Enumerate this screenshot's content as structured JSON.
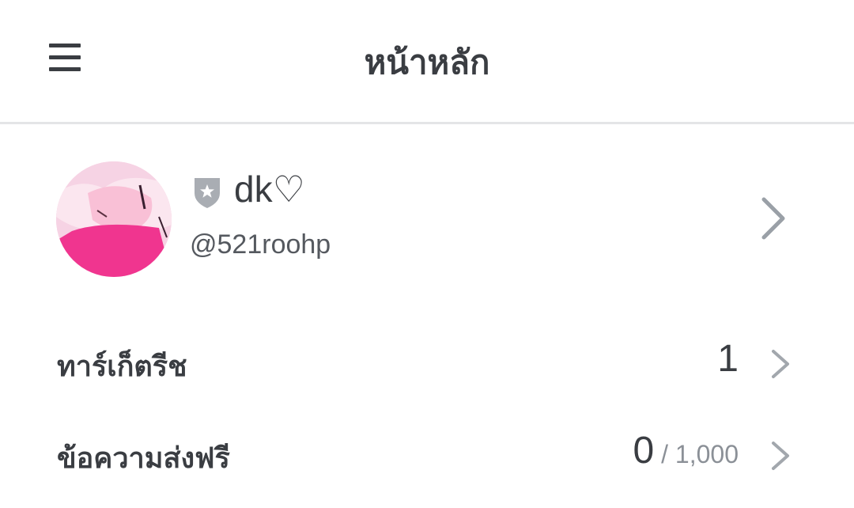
{
  "header": {
    "title": "หน้าหลัก",
    "menu_icon": "hamburger-menu-icon"
  },
  "profile": {
    "display_name": "dk♡",
    "handle": "@521roohp",
    "badge_icon": "shield-star-icon",
    "chevron_icon": "chevron-right-icon"
  },
  "rows": [
    {
      "label": "ทาร์เก็ตรีช",
      "value": "1",
      "total": ""
    },
    {
      "label": "ข้อความส่งฟรี",
      "value": "0",
      "total": " / 1,000"
    }
  ],
  "colors": {
    "text": "#3a3d42",
    "muted": "#8b9097",
    "divider": "#e4e5e7",
    "badge": "#a9adb3",
    "avatar_pink": "#f0358f"
  }
}
